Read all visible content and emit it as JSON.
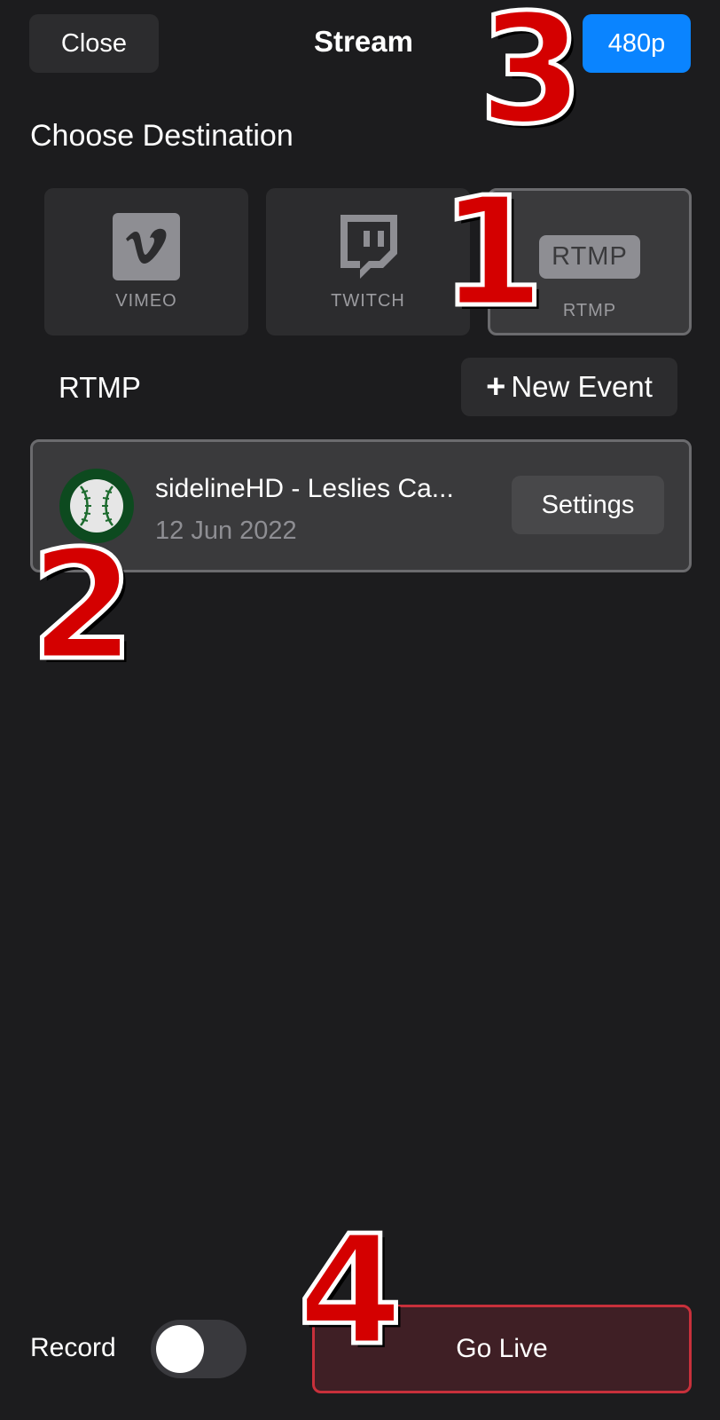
{
  "header": {
    "close_label": "Close",
    "title": "Stream",
    "resolution_label": "480p"
  },
  "destinations": {
    "heading": "Choose Destination",
    "items": [
      {
        "label": "VIMEO",
        "icon": "vimeo-icon",
        "selected": false
      },
      {
        "label": "TWITCH",
        "icon": "twitch-icon",
        "selected": false
      },
      {
        "label": "RTMP",
        "badge": "RTMP",
        "icon": "rtmp-icon",
        "selected": true
      }
    ]
  },
  "rtmp_section": {
    "heading": "RTMP",
    "new_event_label": "New Event"
  },
  "event": {
    "title": "sidelineHD - Leslies Ca...",
    "date": "12 Jun 2022",
    "settings_label": "Settings",
    "avatar_icon": "baseball-icon"
  },
  "bottom": {
    "record_label": "Record",
    "record_on": false,
    "go_live_label": "Go Live"
  },
  "annotations": [
    "1",
    "2",
    "3",
    "4"
  ],
  "colors": {
    "background": "#1c1c1e",
    "accent_blue": "#0a84ff",
    "go_live_border": "#c8303b",
    "annotation_red": "#d40000"
  }
}
